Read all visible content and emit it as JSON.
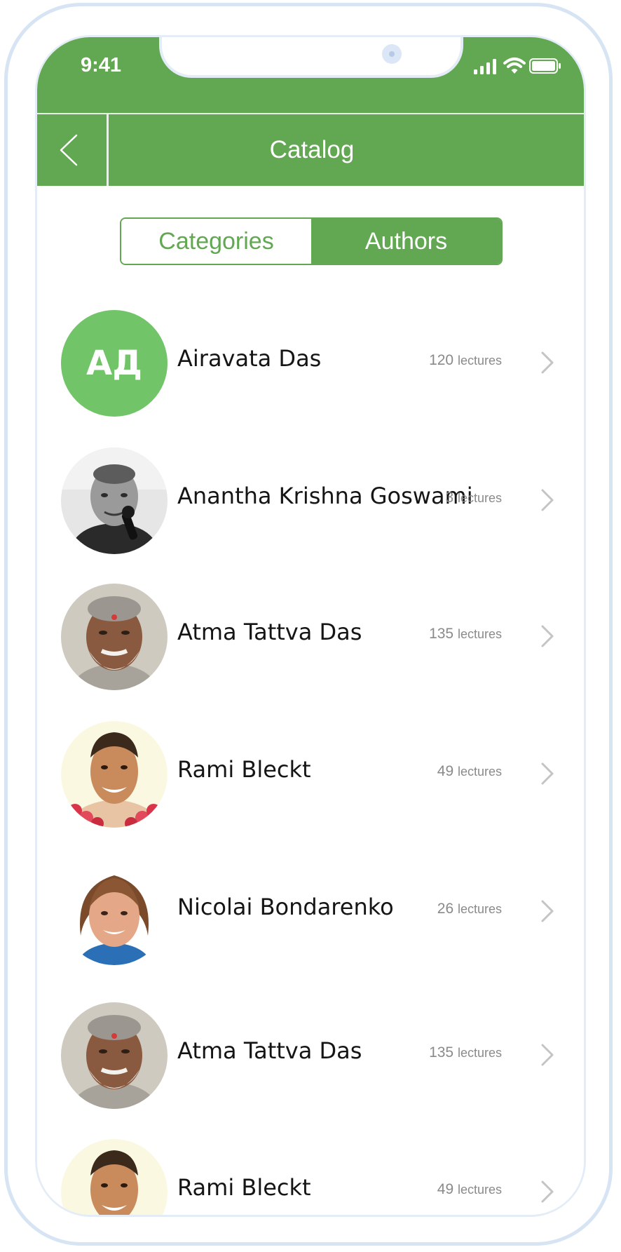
{
  "status_bar": {
    "time": "9:41",
    "signal_icon": "cellular-signal-icon",
    "wifi_icon": "wifi-icon",
    "battery_icon": "battery-full-icon"
  },
  "nav_bar": {
    "back_icon": "chevron-left-icon",
    "title": "Catalog"
  },
  "tabs": [
    {
      "label": "Categories",
      "selected": false
    },
    {
      "label": "Authors",
      "selected": true
    }
  ],
  "authors": [
    {
      "name": "Airavata Das",
      "count": "120",
      "unit": "lectures",
      "avatar": "initials",
      "initials": "АД"
    },
    {
      "name": "Anantha Krishna Goswami",
      "count": "3",
      "unit": "lectures",
      "avatar": "photo-bw-man-microphone"
    },
    {
      "name": "Atma Tattva Das",
      "count": "135",
      "unit": "lectures",
      "avatar": "photo-elderly-man-beard"
    },
    {
      "name": "Rami Bleckt",
      "count": "49",
      "unit": "lectures",
      "avatar": "photo-smiling-man-garland"
    },
    {
      "name": "Nicolai Bondarenko",
      "count": "26",
      "unit": "lectures",
      "avatar": "photo-young-man-long-hair"
    },
    {
      "name": "Atma Tattva Das",
      "count": "135",
      "unit": "lectures",
      "avatar": "photo-elderly-man-beard"
    },
    {
      "name": "Rami Bleckt",
      "count": "49",
      "unit": "lectures",
      "avatar": "photo-smiling-man-garland"
    }
  ],
  "colors": {
    "primary_green": "#62a752",
    "avatar_green": "#72c468",
    "frame": "#d6e4f4",
    "text_dark": "#151515",
    "text_muted": "#8a8a8a",
    "chevron": "#c4c4c4"
  }
}
